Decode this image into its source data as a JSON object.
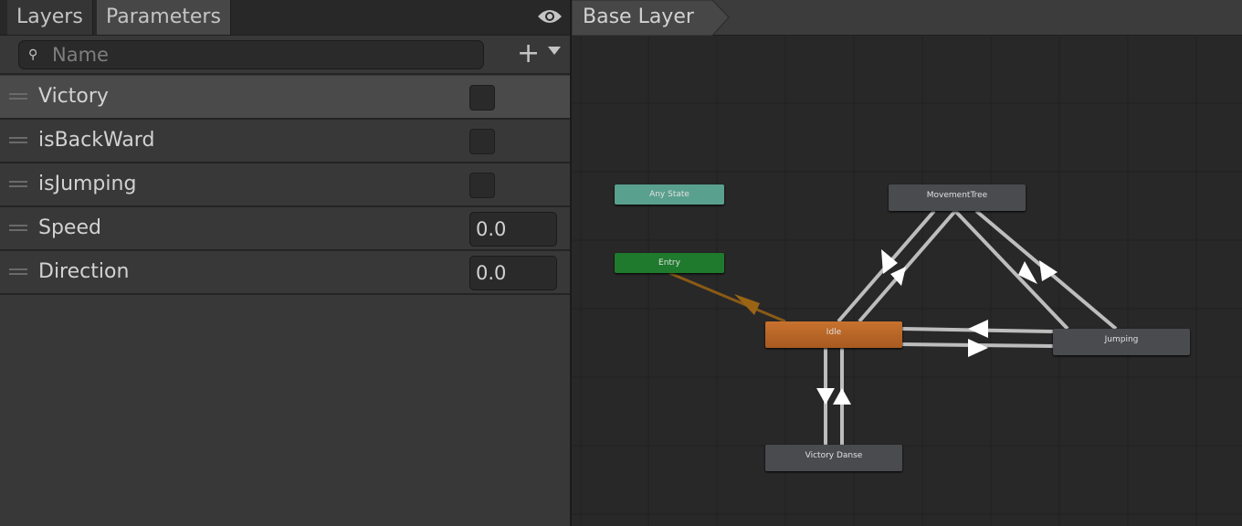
{
  "tabs": [
    {
      "label": "Layers",
      "active": false
    },
    {
      "label": "Parameters",
      "active": true
    }
  ],
  "visibility_icon": "eye-icon",
  "search": {
    "placeholder": "Name",
    "value": "",
    "icon": "search-icon"
  },
  "add_button": {
    "label": "+",
    "icon": "plus-icon"
  },
  "parameters": [
    {
      "name": "Victory",
      "type": "bool",
      "value": false,
      "selected": true
    },
    {
      "name": "isBackWard",
      "type": "bool",
      "value": false
    },
    {
      "name": "isJumping",
      "type": "bool",
      "value": false
    },
    {
      "name": "Speed",
      "type": "float",
      "value": "0.0"
    },
    {
      "name": "Direction",
      "type": "float",
      "value": "0.0"
    }
  ],
  "breadcrumb": {
    "layer": "Base Layer"
  },
  "states": {
    "any_state": {
      "label": "Any State",
      "color": "#5aa08e"
    },
    "entry": {
      "label": "Entry",
      "color": "#1f7a2e"
    },
    "movement_tree": {
      "label": "MovementTree",
      "color": "#4a4b4f"
    },
    "idle": {
      "label": "Idle",
      "color": "#c8722e",
      "default": true
    },
    "jumping": {
      "label": "Jumping",
      "color": "#4a4b4f"
    },
    "victory_danse": {
      "label": "Victory Danse",
      "color": "#4a4b4f"
    }
  },
  "transitions": [
    {
      "from": "Entry",
      "to": "Idle"
    },
    {
      "from": "Idle",
      "to": "MovementTree"
    },
    {
      "from": "MovementTree",
      "to": "Idle"
    },
    {
      "from": "MovementTree",
      "to": "Jumping"
    },
    {
      "from": "Jumping",
      "to": "MovementTree"
    },
    {
      "from": "Idle",
      "to": "Jumping"
    },
    {
      "from": "Jumping",
      "to": "Idle"
    },
    {
      "from": "Idle",
      "to": "Victory Danse"
    },
    {
      "from": "Victory Danse",
      "to": "Idle"
    }
  ]
}
